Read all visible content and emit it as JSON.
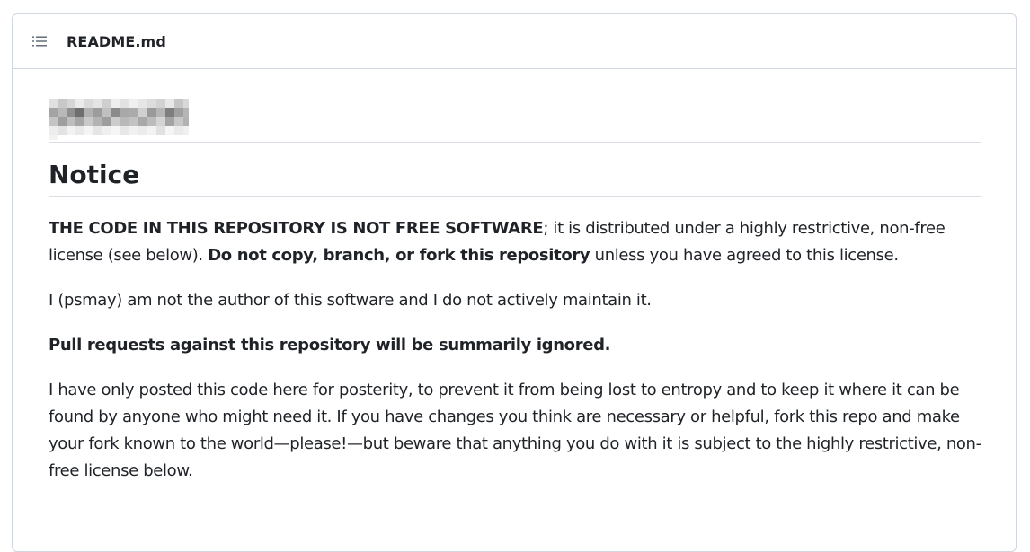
{
  "header": {
    "file_name": "README.md",
    "outline_icon": "list-unordered-icon"
  },
  "readme": {
    "redacted_title": "redacted-pixelated-heading",
    "notice_heading": "Notice",
    "p1": {
      "bold1": "THE CODE IN THIS REPOSITORY IS NOT FREE SOFTWARE",
      "text1": "; it is distributed under a highly restrictive, non-free license (see below). ",
      "bold2": "Do not copy, branch, or fork this repository",
      "text2": " unless you have agreed to this license."
    },
    "p2": "I (psmay) am not the author of this software and I do not actively maintain it.",
    "p3": "Pull requests against this repository will be summarily ignored.",
    "p4": "I have only posted this code here for posterity, to prevent it from being lost to entropy and to keep it where it can be found by anyone who might need it. If you have changes you think are necessary or helpful, fork this repo and make your fork known to the world—please!—but beware that anything you do with it is subject to the highly restrictive, non-free license below."
  }
}
